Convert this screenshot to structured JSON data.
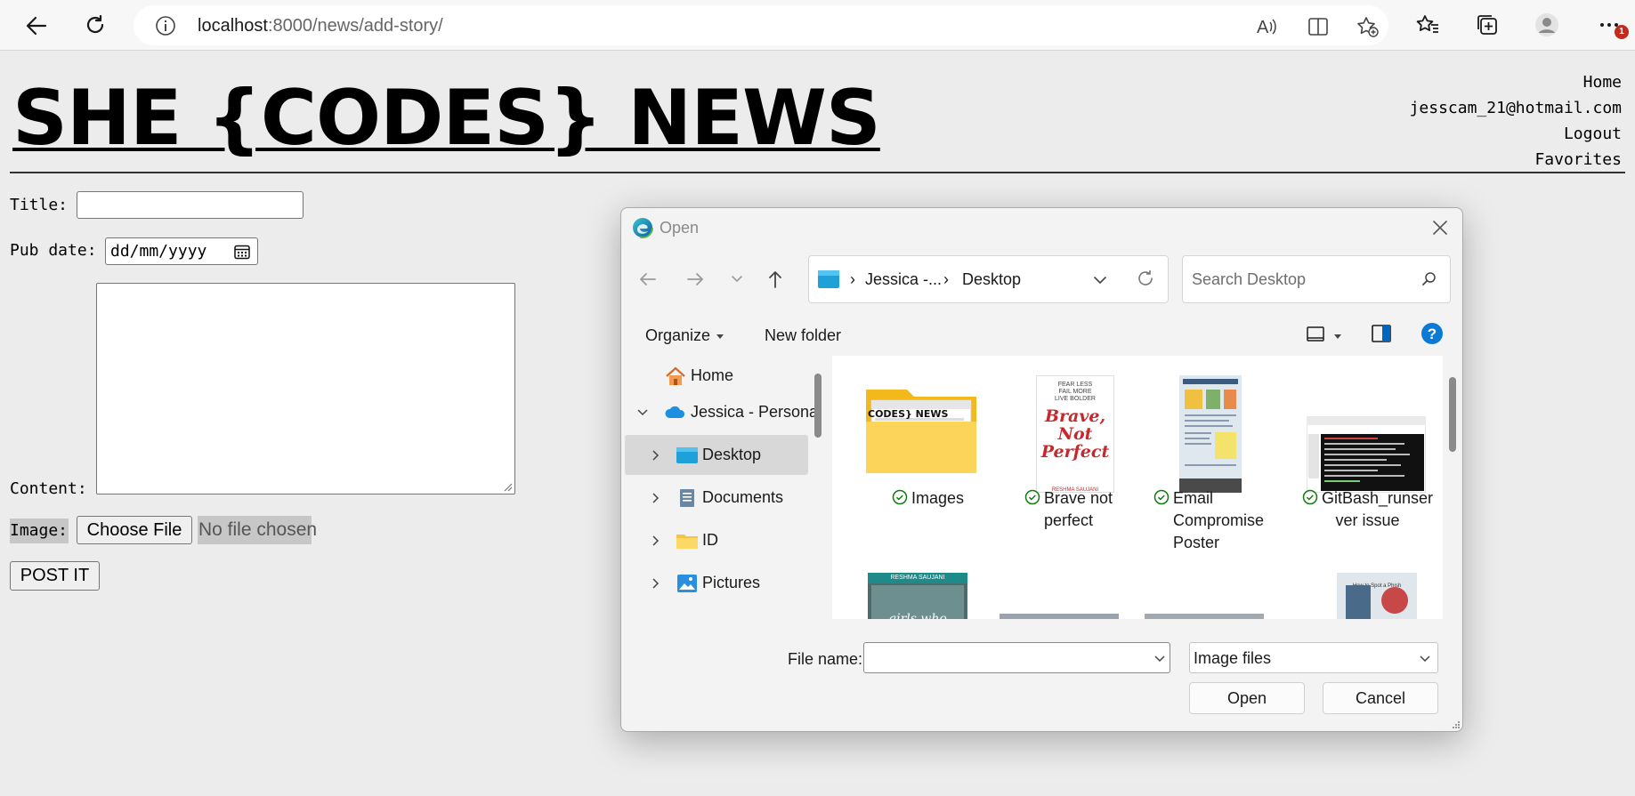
{
  "browser": {
    "url_host": "localhost",
    "url_path": ":8000/news/add-story/",
    "notification_count": "1"
  },
  "site": {
    "title": "SHE {CODES} NEWS",
    "nav": {
      "home": "Home",
      "email": "jesscam_21@hotmail.com",
      "logout": "Logout",
      "favorites": "Favorites"
    }
  },
  "form": {
    "title_label": "Title:",
    "title_value": "",
    "pub_date_label": "Pub date:",
    "pub_date_placeholder": "dd/mm/yyyy",
    "content_label": "Content:",
    "image_label": "Image:",
    "choose_file_label": "Choose File",
    "no_file_text": "No file chosen",
    "submit_label": "POST IT"
  },
  "dialog": {
    "title": "Open",
    "breadcrumb": [
      "Jessica -...",
      "Desktop"
    ],
    "search_placeholder": "Search Desktop",
    "organize_label": "Organize",
    "new_folder_label": "New folder",
    "tree": [
      {
        "label": "Home",
        "expandable": false,
        "selected": false
      },
      {
        "label": "Jessica - Persona",
        "expandable": true,
        "expanded": true,
        "selected": false
      },
      {
        "label": "Desktop",
        "expandable": true,
        "selected": true
      },
      {
        "label": "Documents",
        "expandable": true,
        "selected": false
      },
      {
        "label": "ID",
        "expandable": true,
        "selected": false
      },
      {
        "label": "Pictures",
        "expandable": true,
        "selected": false
      }
    ],
    "files": [
      {
        "name": "Images",
        "type": "folder",
        "folder_label": "CODES} NEWS",
        "synced": true
      },
      {
        "name_lines": [
          "Brave not",
          "perfect"
        ],
        "type": "image",
        "book_top": "FEAR LESS\nFAIL MORE\nLIVE BOLDER",
        "book_title": "Brave, Not Perfect",
        "book_author": "RESHMA SAUJANI",
        "synced": true
      },
      {
        "name_lines": [
          "Email",
          "Compromise",
          "Poster"
        ],
        "type": "image",
        "synced": true
      },
      {
        "name_lines": [
          "GitBash_runser",
          "ver issue"
        ],
        "type": "image",
        "synced": true
      }
    ],
    "second_row": [
      {
        "type": "image",
        "banner": "RESHMA SAUJANI",
        "caption": "girls who"
      },
      {
        "type": "image"
      },
      {
        "type": "image"
      },
      {
        "type": "image",
        "caption": "How to Spot a Phish"
      }
    ],
    "file_name_label": "File name:",
    "file_name_value": "",
    "file_type_value": "Image files",
    "open_label": "Open",
    "cancel_label": "Cancel"
  },
  "colors": {
    "page_bg": "#ececec",
    "accent": "#0067c0",
    "sync_green": "#0f7b0f",
    "badge_red": "#c42b1c"
  }
}
